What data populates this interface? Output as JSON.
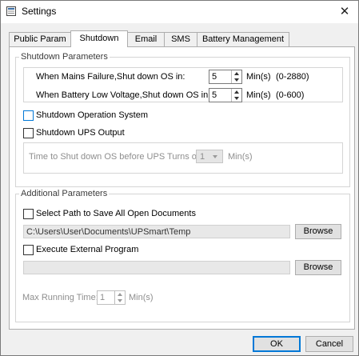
{
  "window": {
    "title": "Settings",
    "close_glyph": "✕",
    "icon": "app-settings-icon"
  },
  "tabs": [
    {
      "label": "Public Param"
    },
    {
      "label": "Shutdown",
      "active": true
    },
    {
      "label": "Email"
    },
    {
      "label": "SMS"
    },
    {
      "label": "Battery Management"
    }
  ],
  "shutdown_params": {
    "legend": "Shutdown Parameters",
    "mains_failure": {
      "label": "When Mains Failure,Shut down OS in:",
      "value": "5",
      "unit": "Min(s)",
      "range": "(0-2880)"
    },
    "low_voltage": {
      "label": "When Battery Low Voltage,Shut down OS in:",
      "value": "5",
      "unit": "Min(s)",
      "range": "(0-600)"
    },
    "shutdown_os": {
      "label": "Shutdown Operation System",
      "checked": false
    },
    "shutdown_ups": {
      "label": "Shutdown UPS Output",
      "checked": false
    },
    "ups_turn_off": {
      "label": "Time to Shut down OS before UPS Turns off:",
      "value": "1",
      "unit": "Min(s)"
    }
  },
  "additional_params": {
    "legend": "Additional Parameters",
    "save_docs": {
      "label": "Select Path to Save All Open Documents",
      "checked": false
    },
    "path": "C:\\Users\\User\\Documents\\UPSmart\\Temp",
    "browse_label": "Browse",
    "external_program": {
      "label": "Execute External Program",
      "checked": false
    },
    "program_path": "",
    "browse2_label": "Browse",
    "max_running": {
      "label": "Max Running Time:",
      "value": "1",
      "unit": "Min(s)"
    }
  },
  "footer": {
    "ok_label": "OK",
    "cancel_label": "Cancel"
  },
  "colors": {
    "accent": "#0078d7",
    "disabled_text": "#8e8e8e",
    "panel_bg": "#ffffff",
    "window_bg": "#f0f0f0"
  }
}
